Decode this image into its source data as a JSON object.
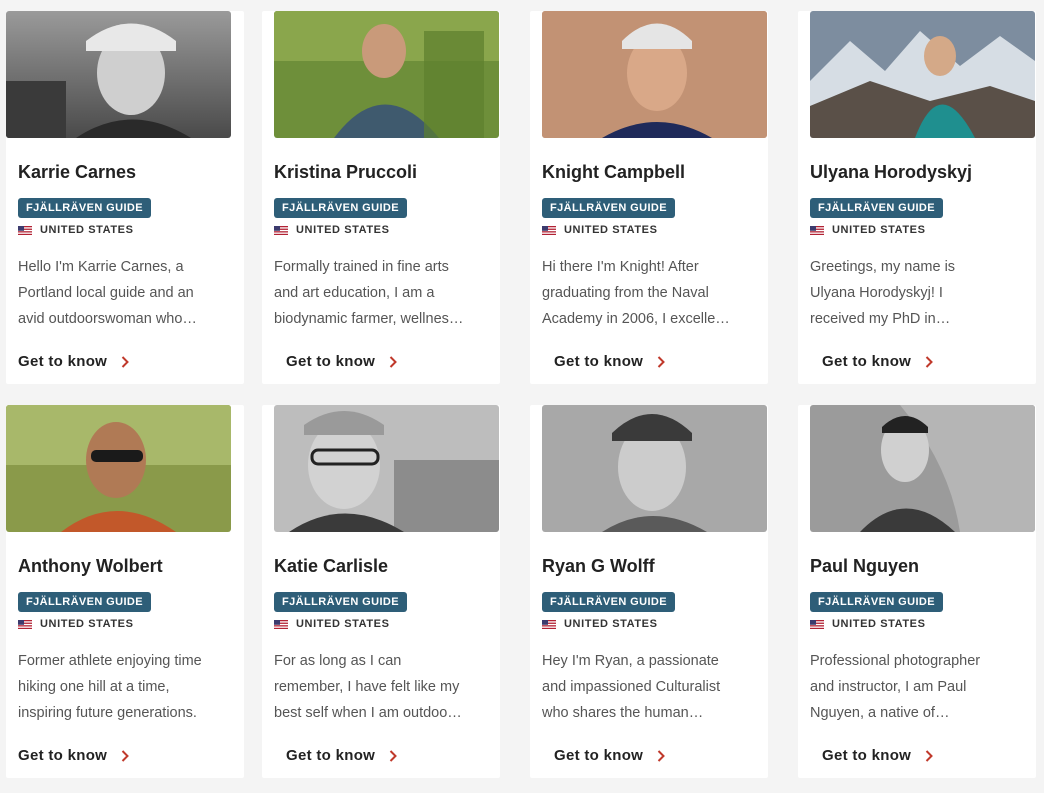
{
  "guides": [
    {
      "name": "Karrie Carnes",
      "badge": "FJÄLLRÄVEN GUIDE",
      "country": "UNITED STATES",
      "desc": [
        "Hello I'm Karrie Carnes, a",
        "Portland local guide and an",
        "avid outdoorswoman who…"
      ],
      "cta": "Get to know"
    },
    {
      "name": "Kristina Pruccoli",
      "badge": "FJÄLLRÄVEN GUIDE",
      "country": "UNITED STATES",
      "desc": [
        "Formally trained in fine arts",
        "and art education, I am a",
        "biodynamic farmer, wellnes…"
      ],
      "cta": "Get to know"
    },
    {
      "name": "Knight Campbell",
      "badge": "FJÄLLRÄVEN GUIDE",
      "country": "UNITED STATES",
      "desc": [
        "Hi there I'm Knight! After",
        "graduating from the Naval",
        "Academy in 2006, I excelle…"
      ],
      "cta": "Get to know"
    },
    {
      "name": "Ulyana Horodyskyj",
      "badge": "FJÄLLRÄVEN GUIDE",
      "country": "UNITED STATES",
      "desc": [
        "Greetings, my name is",
        "Ulyana Horodyskyj! I",
        "received my PhD in…"
      ],
      "cta": "Get to know"
    },
    {
      "name": "Anthony Wolbert",
      "badge": "FJÄLLRÄVEN GUIDE",
      "country": "UNITED STATES",
      "desc": [
        "Former athlete enjoying time",
        "hiking one hill at a time,",
        "inspiring future generations."
      ],
      "cta": "Get to know"
    },
    {
      "name": "Katie Carlisle",
      "badge": "FJÄLLRÄVEN GUIDE",
      "country": "UNITED STATES",
      "desc": [
        "For as long as I can",
        "remember, I have felt like my",
        "best self when I am outdoo…"
      ],
      "cta": "Get to know"
    },
    {
      "name": "Ryan G Wolff",
      "badge": "FJÄLLRÄVEN GUIDE",
      "country": "UNITED STATES",
      "desc": [
        "Hey I'm Ryan, a passionate",
        "and impassioned Culturalist",
        "who shares the human…"
      ],
      "cta": "Get to know"
    },
    {
      "name": "Paul Nguyen",
      "badge": "FJÄLLRÄVEN GUIDE",
      "country": "UNITED STATES",
      "desc": [
        "Professional photographer",
        "and instructor, I am Paul",
        "Nguyen, a native of…"
      ],
      "cta": "Get to know"
    }
  ],
  "colors": {
    "badge": "#2e5e78",
    "chevron": "#c0392b",
    "background": "#f4f4f4"
  }
}
